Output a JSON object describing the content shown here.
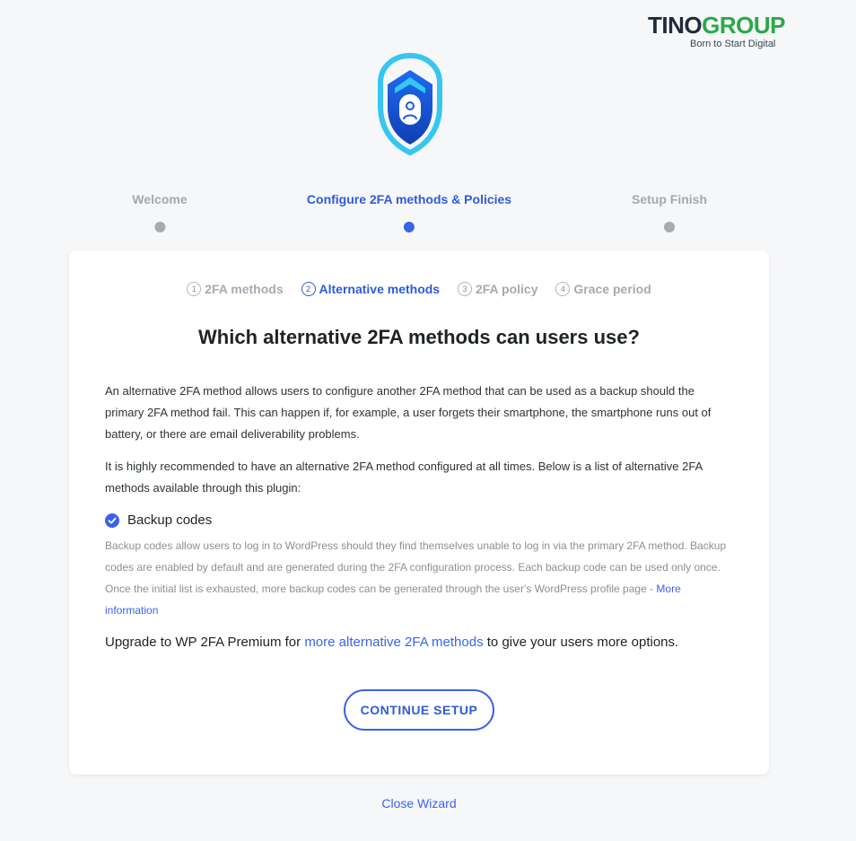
{
  "brand": {
    "name_part1": "TINO",
    "name_part2": "GROUP",
    "tagline": "Born to Start Digital"
  },
  "wizard_steps": [
    {
      "label": "Welcome",
      "state": "inactive"
    },
    {
      "label": "Configure 2FA methods & Policies",
      "state": "active"
    },
    {
      "label": "Setup Finish",
      "state": "inactive"
    }
  ],
  "sub_steps": [
    {
      "num": "1",
      "label": "2FA methods"
    },
    {
      "num": "2",
      "label": "Alternative methods"
    },
    {
      "num": "3",
      "label": "2FA policy"
    },
    {
      "num": "4",
      "label": "Grace period"
    }
  ],
  "heading": "Which alternative 2FA methods can users use?",
  "intro_p1": "An alternative 2FA method allows users to configure another 2FA method that can be used as a backup should the primary 2FA method fail. This can happen if, for example, a user forgets their smartphone, the smartphone runs out of battery, or there are email deliverability problems.",
  "intro_p2": "It is highly recommended to have an alternative 2FA method configured at all times. Below is a list of alternative 2FA methods available through this plugin:",
  "backup_codes": {
    "label": "Backup codes",
    "checked": true,
    "description": "Backup codes allow users to log in to WordPress should they find themselves unable to log in via the primary 2FA method. Backup codes are enabled by default and are generated during the 2FA configuration process. Each backup code can be used only once. Once the initial list is exhausted, more backup codes can be generated through the user's WordPress profile page - ",
    "more_link": "More information"
  },
  "upgrade": {
    "prefix": "Upgrade to WP 2FA Premium for ",
    "link": "more alternative 2FA methods",
    "suffix": " to give your users more options."
  },
  "continue_button": "CONTINUE SETUP",
  "close_link": "Close Wizard",
  "colors": {
    "accent": "#3b63e8",
    "brand_dark": "#1f2b3a",
    "brand_green": "#2aa84a"
  }
}
